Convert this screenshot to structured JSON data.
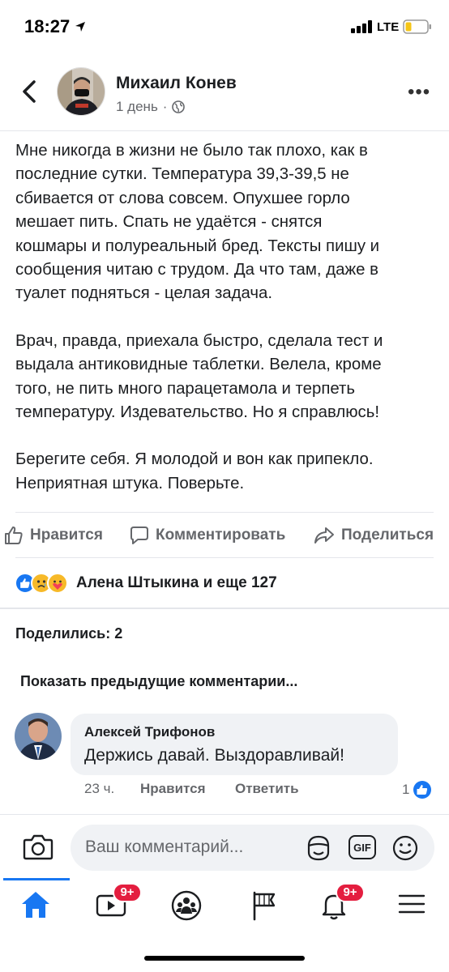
{
  "status_bar": {
    "time": "18:27",
    "network": "LTE"
  },
  "post": {
    "author": "Михаил Конев",
    "time_ago": "1 день",
    "dot": "·",
    "paragraphs": [
      "Мне никогда в жизни не было так плохо, как в\nпоследние сутки. Температура 39,3-39,5 не\nсбивается от слова совсем. Опухшее горло\nмешает пить. Спать не удаётся - снятся\nкошмары и полуреальный бред. Тексты пишу и\nсообщения читаю с трудом. Да что там, даже в\nтуалет подняться - целая задача.",
      "Врач, правда, приехала быстро, сделала тест и\nвыдала антиковидные таблетки. Велела, кроме\nтого, не пить много парацетамола и терпеть\nтемпературу. Издевательство. Но я справлюсь!",
      "Берегите себя. Я молодой и вон как припекло.\nНеприятная штука. Поверьте."
    ]
  },
  "actions": {
    "like": "Нравится",
    "comment": "Комментировать",
    "share": "Поделиться"
  },
  "reactions": {
    "icons": [
      "like-reaction-icon",
      "sad-reaction-icon",
      "care-reaction-icon"
    ],
    "text": "Алена Штыкина и еще 127"
  },
  "shares": "Поделились: 2",
  "prev_comments": "Показать предыдущие комментарии...",
  "comment": {
    "author": "Алексей Трифонов",
    "text": "Держись давай. Выздоравливай!",
    "time": "23 ч.",
    "like": "Нравится",
    "reply": "Ответить",
    "likes_count": "1"
  },
  "composer": {
    "placeholder": "Ваш комментарий...",
    "gif": "GIF"
  },
  "nav": {
    "video_badge": "9+",
    "notifications_badge": "9+"
  },
  "colors": {
    "accent": "#1877f2",
    "badge": "#e41e3f",
    "muted": "#65676b"
  }
}
